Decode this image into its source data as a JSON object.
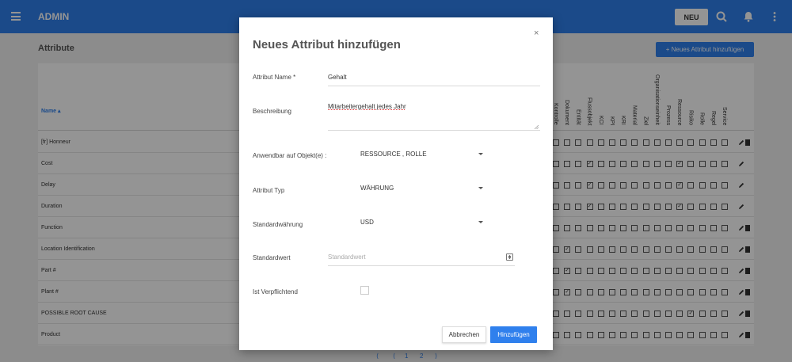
{
  "header": {
    "app_title": "ADMIN",
    "new_label": "NEU",
    "icons": [
      "menu-icon",
      "search-icon",
      "bell-icon",
      "more-vert-icon"
    ]
  },
  "page": {
    "title": "Attribute",
    "add_button": "+ Neues Attribut hinzufügen",
    "name_column": "Name ▴",
    "column_headers": [
      "Kontrolle",
      "Dokument",
      "Entität",
      "Flussobjekt",
      "KCI",
      "KPI",
      "KRI",
      "Material",
      "Ziel",
      "Organisationseinheit",
      "Prozess",
      "Ressource",
      "Risiko",
      "Rolle",
      "Regel",
      "Service"
    ],
    "rows": [
      {
        "name": "[fr] Honneur",
        "checked": [],
        "edit": true,
        "delete": true
      },
      {
        "name": "Cost",
        "checked": [
          3,
          11
        ],
        "edit": true,
        "delete": false
      },
      {
        "name": "Delay",
        "checked": [
          3,
          11
        ],
        "edit": true,
        "delete": false
      },
      {
        "name": "Duration",
        "checked": [
          3,
          11
        ],
        "edit": true,
        "delete": false
      },
      {
        "name": "Function",
        "checked": [],
        "edit": true,
        "delete": true
      },
      {
        "name": "Location Identification",
        "checked": [
          1
        ],
        "edit": true,
        "delete": true
      },
      {
        "name": "Part #",
        "checked": [
          1
        ],
        "edit": true,
        "delete": true
      },
      {
        "name": "Plant #",
        "checked": [
          1
        ],
        "edit": true,
        "delete": true
      },
      {
        "name": "POSSIBLE ROOT CAUSE",
        "checked": [
          12
        ],
        "edit": true,
        "delete": true
      },
      {
        "name": "Product",
        "checked": [],
        "edit": true,
        "delete": true
      }
    ],
    "pagination": [
      "⟨",
      "⟨",
      "1",
      "2",
      "⟩"
    ]
  },
  "modal": {
    "title": "Neues Attribut hinzufügen",
    "close": "×",
    "fields": {
      "name_label": "Attribut Name *",
      "name_value": "Gehalt",
      "desc_label": "Beschreibung",
      "desc_value": "Mitarbeitergehalt jedes Jahr",
      "applies_label": "Anwendbar auf Objekt(e) :",
      "applies_value": "RESSOURCE , ROLLE",
      "type_label": "Attribut Typ",
      "type_value": "WÄHRUNG",
      "currency_label": "Standardwährung",
      "currency_value": "USD",
      "default_label": "Standardwert",
      "default_placeholder": "Standardwert",
      "required_label": "Ist Verpflichtend"
    },
    "cancel_label": "Abbrechen",
    "submit_label": "Hinzufügen"
  },
  "colors": {
    "accent": "#2f80ed"
  }
}
